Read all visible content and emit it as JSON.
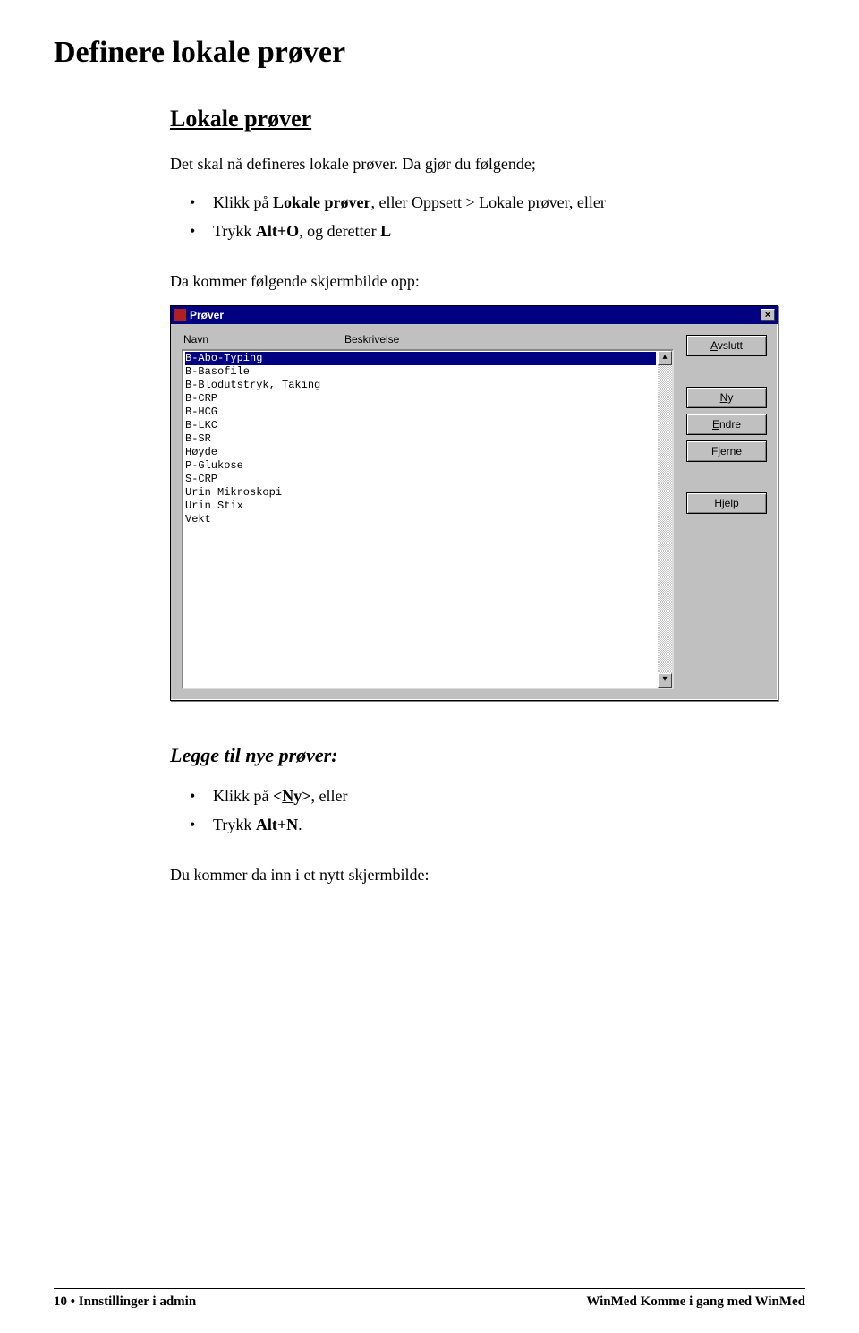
{
  "page": {
    "title": "Definere lokale prøver",
    "sectionTitle": "Lokale prøver",
    "intro": "Det skal nå defineres lokale prøver. Da gjør du følgende;",
    "bullets1": {
      "a_prefix": "Klikk på ",
      "a_bold1": "Lokale prøver",
      "a_mid": ", eller ",
      "a_uO": "O",
      "a_after_u1": "ppsett > ",
      "a_uL": "L",
      "a_after_u2": "okale prøver",
      "a_suffix": ", eller",
      "b_prefix": "Trykk ",
      "b_bold": "Alt+O",
      "b_mid": ", og deretter ",
      "b_bold2": "L"
    },
    "afterBullets": "Da kommer følgende skjermbilde opp:",
    "dialog": {
      "title": "Prøver",
      "closeGlyph": "×",
      "headerNavn": "Navn",
      "headerBeskrivelse": "Beskrivelse",
      "rows": {
        "r0": "B-Abo-Typing",
        "r1": "B-Basofile",
        "r2": "B-Blodutstryk, Taking",
        "r3": "B-CRP",
        "r4": "B-HCG",
        "r5": "B-LKC",
        "r6": "B-SR",
        "r7": "Høyde",
        "r8": "P-Glukose",
        "r9": "S-CRP",
        "r10": "Urin Mikroskopi",
        "r11": "Urin Stix",
        "r12": "Vekt"
      },
      "scrollUp": "▴",
      "scrollDown": "▾",
      "buttons": {
        "avslutt_u": "A",
        "avslutt_rest": "vslutt",
        "ny_u": "N",
        "ny_rest": "y",
        "endre_u": "E",
        "endre_rest": "ndre",
        "fjerne_pre": "F",
        "fjerne_u": "j",
        "fjerne_rest": "erne",
        "hjelp_u": "H",
        "hjelp_rest": "jelp"
      }
    },
    "subTitle": "Legge til nye prøver:",
    "bullets2": {
      "a_prefix": "Klikk på ",
      "a_lt": "<",
      "a_uN": "N",
      "a_bold_rest": "y>",
      "a_suffix": ", eller",
      "b_prefix": "Trykk ",
      "b_bold": "Alt+N",
      "b_suffix": "."
    },
    "closing": "Du kommer da inn i et nytt skjermbilde:"
  },
  "footer": {
    "left_num": "10",
    "left_sep": "  •  ",
    "left_text": "Innstillinger i admin",
    "right": "WinMed  Komme i gang med WinMed"
  }
}
